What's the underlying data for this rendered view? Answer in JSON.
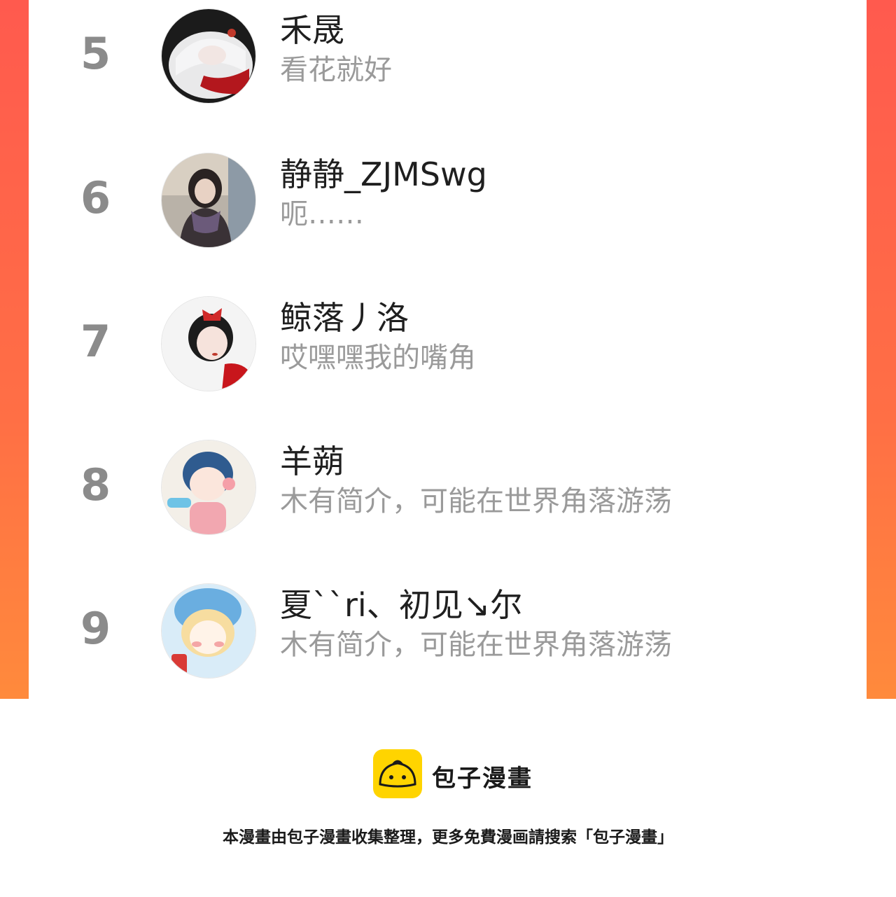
{
  "ranking": {
    "items": [
      {
        "rank": "5",
        "name": "禾晟",
        "bio": "看花就好",
        "avatar_icon": "avatar-white-hair-portrait"
      },
      {
        "rank": "6",
        "name": "静静_ZJMSwg",
        "bio": "呃……",
        "avatar_icon": "avatar-girl-scarf-photo"
      },
      {
        "rank": "7",
        "name": "鲸落丿洛",
        "bio": "哎嘿嘿我的嘴角",
        "avatar_icon": "avatar-girl-red-bow"
      },
      {
        "rank": "8",
        "name": "羊蒴",
        "bio": "木有简介，可能在世界角落游荡",
        "avatar_icon": "avatar-anime-blue-hair"
      },
      {
        "rank": "9",
        "name": "夏``ri、初见↘尔",
        "bio": "木有简介，可能在世界角落游荡",
        "avatar_icon": "avatar-anime-blonde-girl"
      }
    ]
  },
  "footer": {
    "brand": "包子漫畫",
    "note": "本漫畫由包子漫畫收集整理，更多免費漫画請搜索「包子漫畫」"
  },
  "colors": {
    "frame_top": "#ff5a4e",
    "frame_bottom": "#ff8a3c",
    "rank": "#8b8b8b",
    "bio": "#9a9a9a",
    "logo": "#ffd400"
  }
}
